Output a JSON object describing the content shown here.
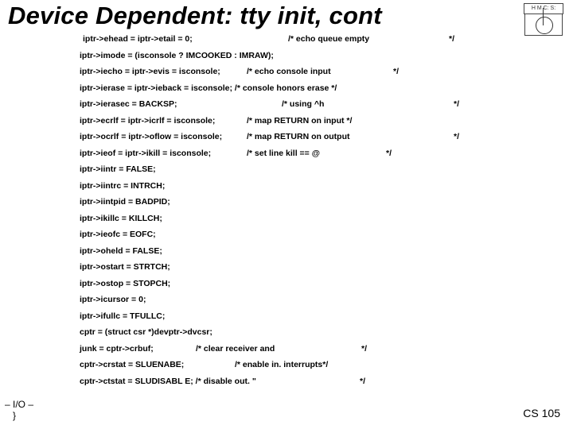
{
  "title": "Device Dependent:  tty  init, cont",
  "logo_text": "H M C: S:",
  "code": {
    "l1": "iptr->ehead = iptr->etail = 0;",
    "l1c": "/* echo queue empty",
    "l1e": "*/",
    "l2": "iptr->imode = (isconsole ? IMCOOKED : IMRAW);",
    "l3": "iptr->iecho = iptr->evis = isconsole;",
    "l3c": "/* echo console input",
    "l3e": "*/",
    "l4": "iptr->ierase = iptr->ieback = isconsole; /* console honors erase */",
    "l5": "iptr->ierasec = BACKSP;",
    "l5c": "/* using ^h",
    "l5e": "*/",
    "l6": "iptr->ecrlf = iptr->icrlf = isconsole;",
    "l6c": "/* map RETURN on input */",
    "l7": "iptr->ocrlf = iptr->oflow = isconsole;",
    "l7c": "/* map RETURN on output",
    "l7e": "*/",
    "l8": "iptr->ieof  = iptr->ikill = isconsole;",
    "l8c": "/* set line kill == @",
    "l8e": "*/",
    "l9": "iptr->iintr = FALSE;",
    "l10": "iptr->iintrc = INTRCH;",
    "l11": "iptr->iintpid = BADPID;",
    "l12": "iptr->ikillc = KILLCH;",
    "l13": "iptr->ieofc = EOFC;",
    "l14": "iptr->oheld = FALSE;",
    "l15": "iptr->ostart = STRTCH;",
    "l16": "iptr->ostop = STOPCH;",
    "l17": "iptr->icursor = 0;",
    "l18": "iptr->ifullc = TFULLC;",
    "l19": "cptr = (struct csr *)devptr->dvcsr;",
    "l20": "junk = cptr->crbuf;",
    "l20c": "/* clear receiver and",
    "l20e": "*/",
    "l21": "cptr->crstat = SLUENABE;",
    "l21c": "/* enable in. interrupts*/",
    "l22": "cptr->ctstat = SLUDISABL    E; /* disable out.    \"",
    "l22e": "*/"
  },
  "footer": {
    "left_line1": "– I/O –",
    "left_line2": "}",
    "right": "CS 105"
  }
}
